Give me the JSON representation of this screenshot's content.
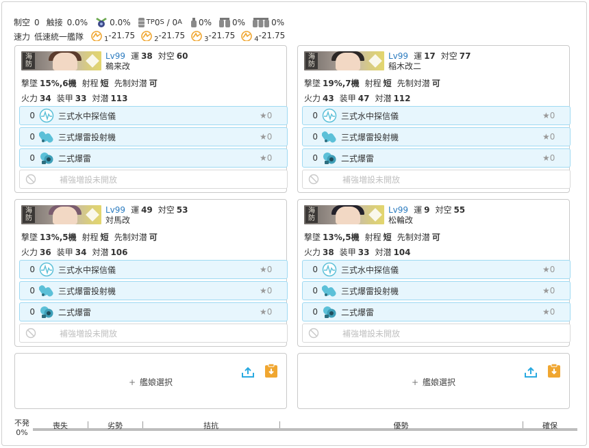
{
  "stats": {
    "air_label": "制空",
    "air_value": "0",
    "contact_label": "触接",
    "contact_value": "0.0%",
    "plane_pct": "0.0%",
    "tp_prefix": "TP",
    "tp_s": "0",
    "tp_s_sub": "S",
    "tp_sep": " / ",
    "tp_a": "0",
    "tp_a_sub": "A",
    "drum1": "0%",
    "drum2": "0%",
    "drum3": "0%",
    "speed_label": "速力",
    "speed_value": "低速統一艦隊",
    "los": [
      {
        "sub": "1",
        "val": "-21.75"
      },
      {
        "sub": "2",
        "val": "-21.75"
      },
      {
        "sub": "3",
        "val": "-21.75"
      },
      {
        "sub": "4",
        "val": "-21.75"
      }
    ]
  },
  "labels": {
    "luck": "運",
    "aa": "対空",
    "shootdown": "撃墜",
    "range": "射程",
    "oasw": "先制対潜",
    "fp": "火力",
    "armor": "装甲",
    "asw": "対潜",
    "banner_kanji": "海\n防"
  },
  "ships": [
    {
      "lv": "Lv99",
      "luck": "38",
      "aa": "60",
      "name": "鵜来改",
      "shootdown": "15%,6機",
      "range": "短",
      "oasw": "可",
      "fp": "34",
      "armor": "33",
      "asw": "113",
      "hair": "#5a3b2c",
      "equip": [
        {
          "count": "0",
          "icon": "sonar-icon",
          "name": "三式水中探信儀",
          "star": "★0"
        },
        {
          "count": "0",
          "icon": "depth-charge-projector-icon",
          "name": "三式爆雷投射機",
          "star": "★0"
        },
        {
          "count": "0",
          "icon": "depth-charge-icon",
          "name": "二式爆雷",
          "star": "★0"
        }
      ],
      "ex_slot": "補強増設未開放"
    },
    {
      "lv": "Lv99",
      "luck": "17",
      "aa": "77",
      "name": "稲木改二",
      "shootdown": "19%,7機",
      "range": "短",
      "oasw": "可",
      "fp": "43",
      "armor": "47",
      "asw": "112",
      "hair": "#2b2726",
      "equip": [
        {
          "count": "0",
          "icon": "sonar-icon",
          "name": "三式水中探信儀",
          "star": "★0"
        },
        {
          "count": "0",
          "icon": "depth-charge-projector-icon",
          "name": "三式爆雷投射機",
          "star": "★0"
        },
        {
          "count": "0",
          "icon": "depth-charge-icon",
          "name": "二式爆雷",
          "star": "★0"
        }
      ],
      "ex_slot": "補強増設未開放"
    },
    {
      "lv": "Lv99",
      "luck": "49",
      "aa": "53",
      "name": "対馬改",
      "shootdown": "13%,5機",
      "range": "短",
      "oasw": "可",
      "fp": "36",
      "armor": "34",
      "asw": "106",
      "hair": "#7a5c6e",
      "equip": [
        {
          "count": "0",
          "icon": "sonar-icon",
          "name": "三式水中探信儀",
          "star": "★0"
        },
        {
          "count": "0",
          "icon": "depth-charge-projector-icon",
          "name": "三式爆雷投射機",
          "star": "★0"
        },
        {
          "count": "0",
          "icon": "depth-charge-icon",
          "name": "二式爆雷",
          "star": "★0"
        }
      ],
      "ex_slot": "補強増設未開放"
    },
    {
      "lv": "Lv99",
      "luck": "9",
      "aa": "55",
      "name": "松輪改",
      "shootdown": "13%,5機",
      "range": "短",
      "oasw": "可",
      "fp": "38",
      "armor": "33",
      "asw": "104",
      "hair": "#23212a",
      "equip": [
        {
          "count": "0",
          "icon": "sonar-icon",
          "name": "三式水中探信儀",
          "star": "★0"
        },
        {
          "count": "0",
          "icon": "depth-charge-projector-icon",
          "name": "三式爆雷投射機",
          "star": "★0"
        },
        {
          "count": "0",
          "icon": "depth-charge-icon",
          "name": "二式爆雷",
          "star": "★0"
        }
      ],
      "ex_slot": "補強増設未開放"
    }
  ],
  "add_slots": [
    {
      "plus": "+",
      "label": "艦娘選択"
    },
    {
      "plus": "+",
      "label": "艦娘選択"
    }
  ],
  "winbar": {
    "left_top": "不発",
    "left_bottom": "0%",
    "segments": [
      "喪失",
      "劣勢",
      "拮抗",
      "優勢",
      "確保"
    ]
  },
  "colors": {
    "lv_blue": "#2b7bbf",
    "equip_bg": "#e7f6fd",
    "equip_border": "#9ed9f2",
    "icon_cyan": "#5cc0d8",
    "import_blue": "#29a9e0",
    "clip_orange": "#f0a630"
  }
}
